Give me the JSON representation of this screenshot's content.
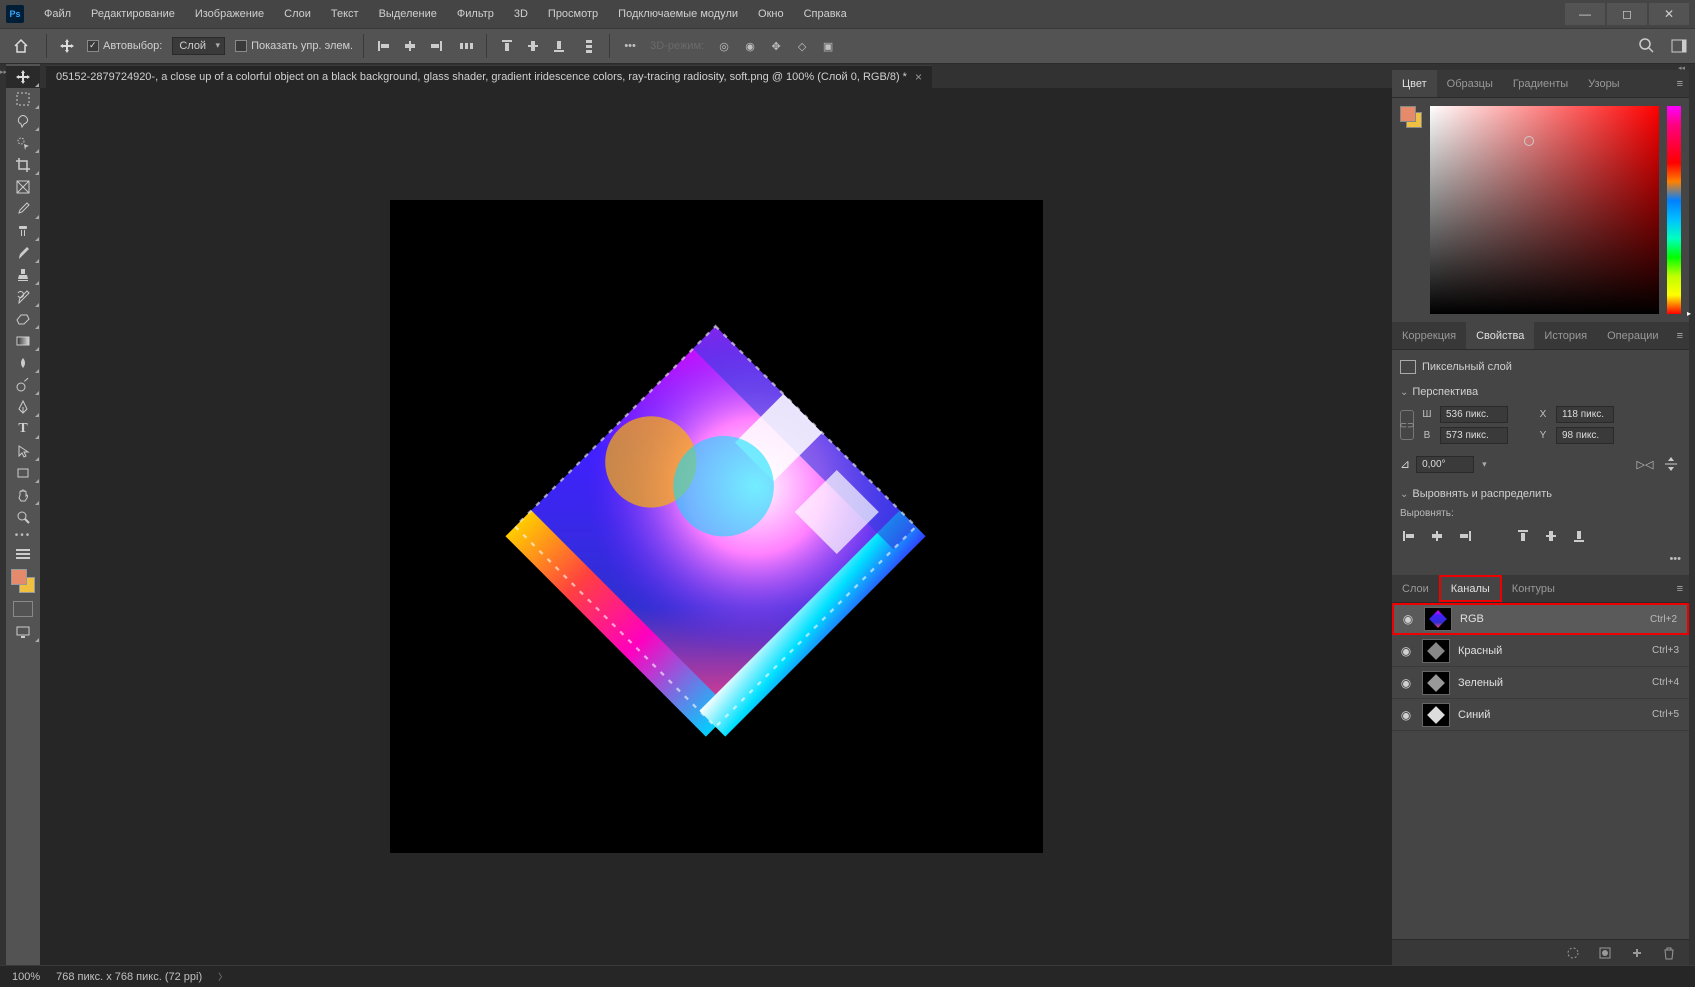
{
  "menu": {
    "items": [
      "Файл",
      "Редактирование",
      "Изображение",
      "Слои",
      "Текст",
      "Выделение",
      "Фильтр",
      "3D",
      "Просмотр",
      "Подключаемые модули",
      "Окно",
      "Справка"
    ]
  },
  "options": {
    "autoSelect": "Автовыбор:",
    "autoSelectMode": "Слой",
    "showControls": "Показать упр. элем.",
    "threeDMode": "3D-режим:"
  },
  "docTab": "05152-2879724920-, a close up of a colorful object on a black background, glass shader, gradient iridescence colors, ray-tracing radiosity, soft.png @ 100% (Слой 0, RGB/8) *",
  "colorTabs": [
    "Цвет",
    "Образцы",
    "Градиенты",
    "Узоры"
  ],
  "propsTabs": [
    "Коррекция",
    "Свойства",
    "История",
    "Операции"
  ],
  "props": {
    "layerType": "Пиксельный слой",
    "perspective": "Перспектива",
    "wLabel": "Ш",
    "wValue": "536 пикс.",
    "hLabel": "В",
    "hValue": "573 пикс.",
    "xLabel": "X",
    "xValue": "118 пикс.",
    "yLabel": "Y",
    "yValue": "98 пикс.",
    "angle": "0,00°",
    "alignDistribute": "Выровнять и распределить",
    "alignLabel": "Выровнять:"
  },
  "bottomTabs": [
    "Слои",
    "Каналы",
    "Контуры"
  ],
  "channels": [
    {
      "name": "RGB",
      "shortcut": "Ctrl+2",
      "selected": true,
      "color": "rgb"
    },
    {
      "name": "Красный",
      "shortcut": "Ctrl+3",
      "selected": false,
      "color": "red"
    },
    {
      "name": "Зеленый",
      "shortcut": "Ctrl+4",
      "selected": false,
      "color": "green"
    },
    {
      "name": "Синий",
      "shortcut": "Ctrl+5",
      "selected": false,
      "color": "blue"
    }
  ],
  "status": {
    "zoom": "100%",
    "docInfo": "768 пикс. x 768 пикс. (72 ppi)"
  }
}
